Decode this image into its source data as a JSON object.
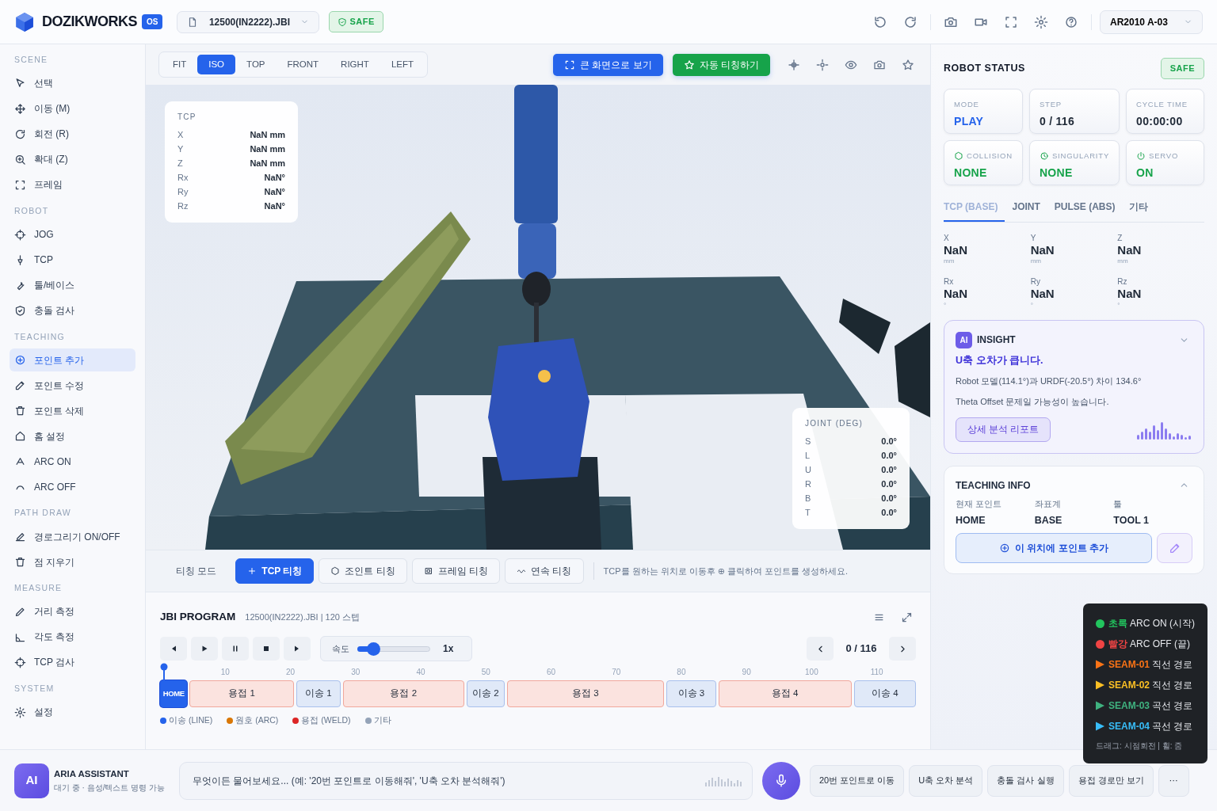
{
  "header": {
    "logo": "DOZIKWORKS",
    "version": "OS",
    "file": "12500(IN2222).JBI",
    "safety": "SAFE",
    "robot": "AR2010 A-03"
  },
  "sidebar": [
    {
      "title": "SCENE",
      "items": [
        {
          "label": "선택",
          "selected": false
        },
        {
          "label": "이동 (M)",
          "selected": false
        },
        {
          "label": "회전 (R)",
          "selected": false
        },
        {
          "label": "확대 (Z)",
          "selected": false
        },
        {
          "label": "프레임",
          "selected": false
        }
      ]
    },
    {
      "title": "ROBOT",
      "items": [
        {
          "label": "JOG",
          "selected": false
        },
        {
          "label": "TCP",
          "selected": false
        },
        {
          "label": "툴/베이스",
          "selected": false
        },
        {
          "label": "충돌 검사",
          "selected": false
        }
      ]
    },
    {
      "title": "TEACHING",
      "items": [
        {
          "label": "포인트 추가",
          "selected": true
        },
        {
          "label": "포인트 수정",
          "selected": false
        },
        {
          "label": "포인트 삭제",
          "selected": false
        },
        {
          "label": "홈 설정",
          "selected": false
        },
        {
          "label": "ARC ON",
          "selected": false
        },
        {
          "label": "ARC OFF",
          "selected": false
        }
      ]
    },
    {
      "title": "PATH DRAW",
      "items": [
        {
          "label": "경로그리기 ON/OFF",
          "selected": false
        },
        {
          "label": "점 지우기",
          "selected": false
        }
      ]
    },
    {
      "title": "MEASURE",
      "items": [
        {
          "label": "거리 측정",
          "selected": false
        },
        {
          "label": "각도 측정",
          "selected": false
        },
        {
          "label": "TCP 검사",
          "selected": false
        }
      ]
    },
    {
      "title": "SYSTEM",
      "items": [
        {
          "label": "설정",
          "selected": false
        }
      ]
    }
  ],
  "view_tabs": [
    {
      "label": "FIT",
      "selected": false
    },
    {
      "label": "ISO",
      "selected": true
    },
    {
      "label": "TOP",
      "selected": false
    },
    {
      "label": "FRONT",
      "selected": false
    },
    {
      "label": "RIGHT",
      "selected": false
    },
    {
      "label": "LEFT",
      "selected": false
    }
  ],
  "view_actions": [
    {
      "label": "큰 화면으로 보기",
      "kind": "primary"
    },
    {
      "label": "자동 티칭하기",
      "kind": "success"
    }
  ],
  "tcp_card": {
    "title": "TCP",
    "rows": [
      {
        "axis": "X",
        "value": "NaN mm"
      },
      {
        "axis": "Y",
        "value": "NaN mm"
      },
      {
        "axis": "Z",
        "value": "NaN mm"
      },
      {
        "axis": "Rx",
        "value": "NaN°"
      },
      {
        "axis": "Ry",
        "value": "NaN°"
      },
      {
        "axis": "Rz",
        "value": "NaN°"
      }
    ]
  },
  "joint_card": {
    "title": "JOINT (DEG)",
    "rows": [
      {
        "axis": "S",
        "value": "0.0°"
      },
      {
        "axis": "L",
        "value": "0.0°"
      },
      {
        "axis": "U",
        "value": "0.0°"
      },
      {
        "axis": "R",
        "value": "0.0°"
      },
      {
        "axis": "B",
        "value": "0.0°"
      },
      {
        "axis": "T",
        "value": "0.0°"
      }
    ]
  },
  "teach_modes": {
    "label": "티칭 모드",
    "modes": [
      {
        "label": "TCP 티칭",
        "selected": true
      },
      {
        "label": "조인트 티칭",
        "selected": false
      },
      {
        "label": "프레임 티칭",
        "selected": false
      },
      {
        "label": "연속 티칭",
        "selected": false
      }
    ],
    "hint": "TCP를 원하는 위치로 이동후 ⊕ 클릭하여 포인트를 생성하세요."
  },
  "program": {
    "title": "JBI PROGRAM",
    "subtitle": "12500(IN2222).JBI | 120 스텝",
    "speed_label": "속도",
    "speed": {
      "level": 0.22
    },
    "speed_reading": "1x",
    "counter": "0 / 116",
    "ticks": [
      "10",
      "20",
      "30",
      "40",
      "50",
      "60",
      "70",
      "80",
      "90",
      "100",
      "110"
    ],
    "segments": [
      {
        "label": "HOME",
        "kind": "home",
        "selected": true
      },
      {
        "label": "용접 1",
        "kind": "weld",
        "selected": false
      },
      {
        "label": "이송 1",
        "kind": "line",
        "selected": false
      },
      {
        "label": "용접 2",
        "kind": "weld",
        "selected": false
      },
      {
        "label": "이송 2",
        "kind": "line",
        "selected": false
      },
      {
        "label": "용접 3",
        "kind": "weld",
        "selected": false
      },
      {
        "label": "이송 3",
        "kind": "line",
        "selected": false
      },
      {
        "label": "용접 4",
        "kind": "weld",
        "selected": false
      },
      {
        "label": "이송 4",
        "kind": "line",
        "selected": false
      }
    ],
    "legend": [
      {
        "label": "이송 (LINE)",
        "color": "#2563eb"
      },
      {
        "label": "원호 (ARC)",
        "color": "#d97706"
      },
      {
        "label": "용접 (WELD)",
        "color": "#dc2626"
      },
      {
        "label": "기타",
        "color": "#94a3b8"
      }
    ]
  },
  "robot_status": {
    "title": "ROBOT STATUS",
    "badge": "SAFE",
    "cards": [
      {
        "label": "MODE",
        "value": "PLAY",
        "kind": "mode"
      },
      {
        "label": "STEP",
        "value": "0 / 116",
        "kind": "plain"
      },
      {
        "label": "CYCLE TIME",
        "value": "00:00:00",
        "kind": "plain"
      },
      {
        "label": "COLLISION",
        "value": "NONE",
        "kind": "collision"
      },
      {
        "label": "SINGULARITY",
        "value": "NONE",
        "kind": "singularity"
      },
      {
        "label": "SERVO",
        "value": "ON",
        "kind": "servo"
      }
    ],
    "tabs": [
      {
        "label": "TCP (BASE)",
        "selected": true
      },
      {
        "label": "JOINT",
        "selected": false
      },
      {
        "label": "PULSE (ABS)",
        "selected": false
      },
      {
        "label": "기타",
        "selected": false
      }
    ],
    "values": [
      {
        "axis": "X",
        "value": "NaN",
        "unit": "mm"
      },
      {
        "axis": "Y",
        "value": "NaN",
        "unit": "mm"
      },
      {
        "axis": "Z",
        "value": "NaN",
        "unit": "mm"
      },
      {
        "axis": "Rx",
        "value": "NaN",
        "unit": "°"
      },
      {
        "axis": "Ry",
        "value": "NaN",
        "unit": "°"
      },
      {
        "axis": "Rz",
        "value": "NaN",
        "unit": "°"
      }
    ]
  },
  "insight": {
    "badge": "AI",
    "title": "INSIGHT",
    "headline": "U축 오차가 큽니다.",
    "lines": [
      "Robot 모델(114.1°)과 URDF(-20.5°) 차이 134.6°",
      "Theta Offset 문제일 가능성이 높습니다."
    ],
    "button": "상세 분석 리포트"
  },
  "teaching_info": {
    "title": "TEACHING INFO",
    "fields": [
      {
        "label": "현재 포인트",
        "value": "HOME"
      },
      {
        "label": "좌표계",
        "value": "BASE"
      },
      {
        "label": "툴",
        "value": "TOOL 1"
      }
    ],
    "button": "이 위치에 포인트 추가"
  },
  "legend_overlay": {
    "items": [
      {
        "kind": "dot",
        "color": "#22c55e",
        "tag": "초록",
        "text": "ARC ON (시작)"
      },
      {
        "kind": "dot",
        "color": "#ef4444",
        "tag": "빨강",
        "text": "ARC OFF (끝)"
      },
      {
        "kind": "triangle",
        "color": "#f97316",
        "tag": "SEAM-01",
        "text": "직선 경로"
      },
      {
        "kind": "triangle",
        "color": "#fbbf24",
        "tag": "SEAM-02",
        "text": "직선 경로"
      },
      {
        "kind": "triangle",
        "color": "#3fb27f",
        "tag": "SEAM-03",
        "text": "곡선 경로"
      },
      {
        "kind": "triangle",
        "color": "#38bdf8",
        "tag": "SEAM-04",
        "text": "곡선 경로"
      }
    ],
    "hint": "드래그: 시점회전 | 휠: 줌"
  },
  "assistant": {
    "avatar": "AI",
    "name": "ARIA ASSISTANT",
    "status": "대기 중 · 음성/텍스트 명령 가능",
    "placeholder": "무엇이든 물어보세요... (예: '20번 포인트로 이동해줘', 'U축 오차 분석해줘')",
    "suggestions": [
      "20번 포인트로 이동",
      "U축 오차 분석",
      "충돌 검사 실행",
      "용접 경로만 보기"
    ],
    "more": "⋯"
  }
}
